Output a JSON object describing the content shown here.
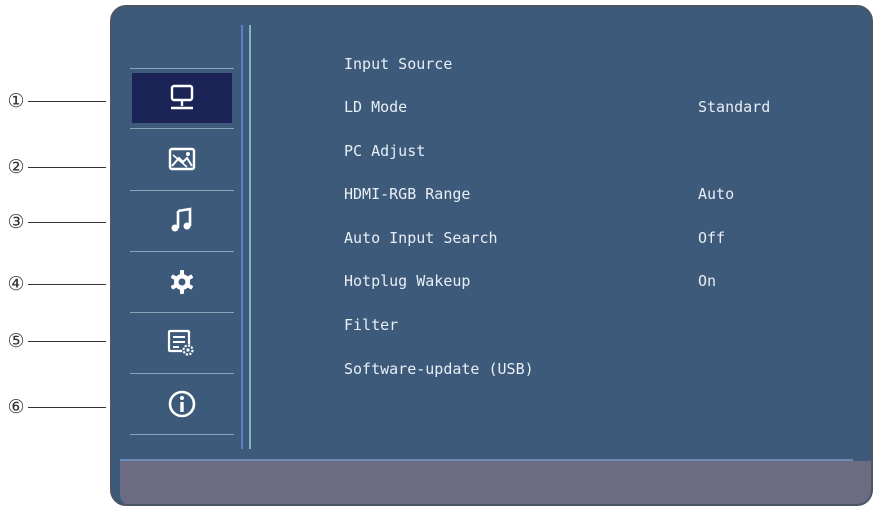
{
  "callouts": [
    "①",
    "②",
    "③",
    "④",
    "⑤",
    "⑥"
  ],
  "sidebar": {
    "tabs": [
      {
        "icon": "monitor-icon",
        "active": true
      },
      {
        "icon": "picture-icon",
        "active": false
      },
      {
        "icon": "music-note-icon",
        "active": false
      },
      {
        "icon": "gear-icon",
        "active": false
      },
      {
        "icon": "settings-list-icon",
        "active": false
      },
      {
        "icon": "info-icon",
        "active": false
      }
    ]
  },
  "menu": {
    "items": [
      {
        "label": "Input Source",
        "value": ""
      },
      {
        "label": "LD Mode",
        "value": "Standard"
      },
      {
        "label": "PC Adjust",
        "value": ""
      },
      {
        "label": "HDMI-RGB Range",
        "value": "Auto"
      },
      {
        "label": "Auto Input Search",
        "value": "Off"
      },
      {
        "label": "Hotplug Wakeup",
        "value": "On"
      },
      {
        "label": "Filter",
        "value": ""
      },
      {
        "label": "Software-update (USB)",
        "value": ""
      }
    ]
  },
  "colors": {
    "panel": "#3d5a7a",
    "active_tab": "#1a2456",
    "footer": "#6c6b82",
    "text": "#e8eef5"
  }
}
